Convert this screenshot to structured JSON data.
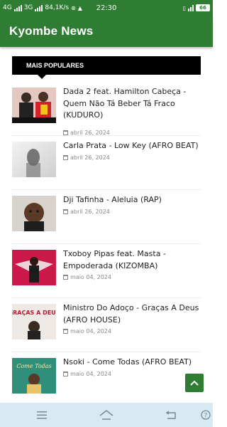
{
  "status_bar": {
    "network_1": "4G",
    "network_2": "3G",
    "speed": "84,1K/s",
    "time": "22:30",
    "battery": "66"
  },
  "app_bar": {
    "title": "Kyombe News"
  },
  "section": {
    "title": "MAIS POPULARES"
  },
  "articles": [
    {
      "title": "Dada 2 feat. Hamilton Cabeça - Quem Não Tá Beber Tá Fraco (KUDURO)",
      "date": "abril 26, 2024"
    },
    {
      "title": "Carla Prata - Low Key (AFRO BEAT)",
      "date": "abril 26, 2024"
    },
    {
      "title": "Dji Tafinha - Aleluia (RAP)",
      "date": "abril 26, 2024"
    },
    {
      "title": "Txoboy Pipas feat. Masta - Empoderada (KIZOMBA)",
      "date": "maio 04, 2024"
    },
    {
      "title": "Ministro Do Adoço - Graças A Deus (AFRO HOUSE)",
      "date": "maio 04, 2024"
    },
    {
      "title": "Nsoki - Come Todas (AFRO BEAT)",
      "date": "maio 04, 2024"
    }
  ],
  "thumb_text": {
    "gracas": "GRAÇAS A DEUS",
    "come": "Come Todas"
  },
  "colors": {
    "primary": "#2e7d32",
    "nav": "#d7e9f3"
  }
}
